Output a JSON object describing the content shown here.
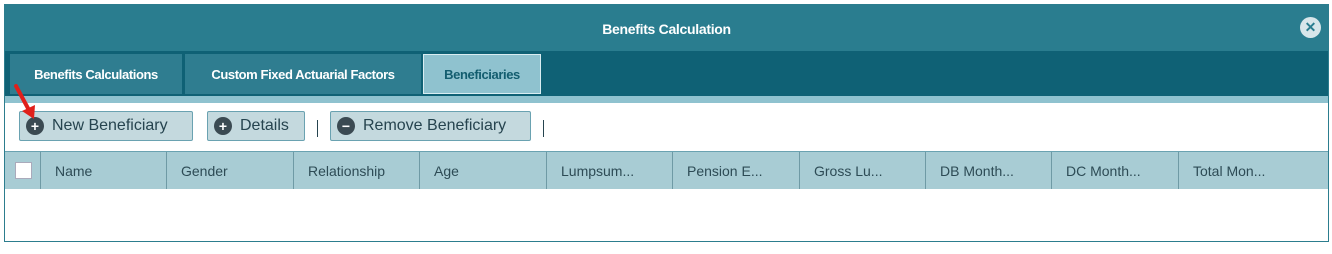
{
  "dialog": {
    "title": "Benefits Calculation",
    "close_icon": "close-circle-icon"
  },
  "tabs": [
    {
      "label": "Benefits Calculations"
    },
    {
      "label": "Custom Fixed Actuarial Factors"
    },
    {
      "label": "Beneficiaries"
    }
  ],
  "toolbar": {
    "new_label": "New Beneficiary",
    "details_label": "Details",
    "remove_label": "Remove Beneficiary"
  },
  "table": {
    "columns": [
      "Name",
      "Gender",
      "Relationship",
      "Age",
      "Lumpsum...",
      "Pension E...",
      "Gross Lu...",
      "DB Month...",
      "DC Month...",
      "Total Mon..."
    ]
  },
  "colors": {
    "accent": "#2a7d8f",
    "tabstrip": "#0f6175",
    "annotation_arrow": "#e0201b"
  }
}
